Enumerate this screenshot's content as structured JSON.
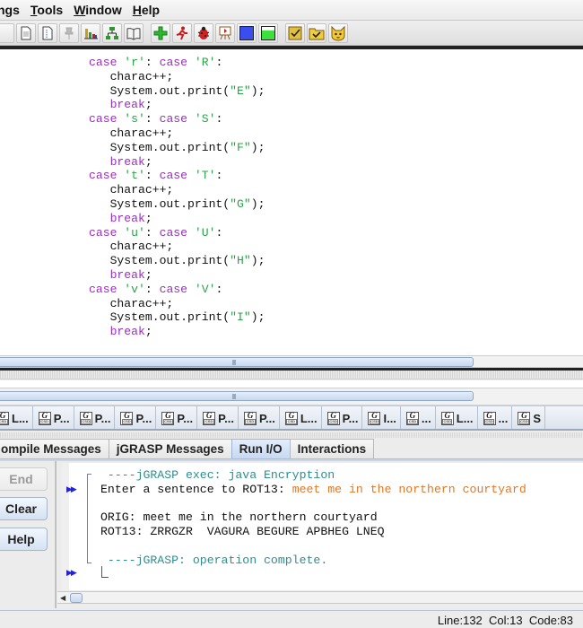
{
  "menubar": {
    "items": [
      {
        "label": "ngs",
        "mnemonic_index": -1
      },
      {
        "label": "Tools",
        "mnemonic_index": 0
      },
      {
        "label": "Window",
        "mnemonic_index": 0
      },
      {
        "label": "Help",
        "mnemonic_index": 0
      }
    ]
  },
  "toolbar": {
    "buttons": [
      {
        "icon": "partial-button"
      },
      {
        "icon": "new-file-icon"
      },
      {
        "icon": "generate-doc-icon"
      },
      {
        "icon": "pin-icon",
        "disabled": true
      },
      {
        "icon": "bar-chart-icon"
      },
      {
        "icon": "uml-diagram-icon"
      },
      {
        "icon": "open-book-icon"
      },
      {
        "icon": "compile-plus-icon"
      },
      {
        "icon": "run-figure-icon"
      },
      {
        "icon": "debug-bug-icon"
      },
      {
        "icon": "presentation-icon"
      },
      {
        "icon": "blue-square-icon"
      },
      {
        "icon": "green-square-icon"
      },
      {
        "icon": "checklist-icon"
      },
      {
        "icon": "folder-check-icon"
      },
      {
        "icon": "cat-face-icon"
      }
    ]
  },
  "editor": {
    "cases": [
      {
        "lower": "'r'",
        "upper": "'R'",
        "out": "\"E\""
      },
      {
        "lower": "'s'",
        "upper": "'S'",
        "out": "\"F\""
      },
      {
        "lower": "'t'",
        "upper": "'T'",
        "out": "\"G\""
      },
      {
        "lower": "'u'",
        "upper": "'U'",
        "out": "\"H\""
      },
      {
        "lower": "'v'",
        "upper": "'V'",
        "out": "\"I\""
      }
    ],
    "kw_case": "case",
    "kw_break": "break",
    "stmt_increment": "charac++;",
    "print_prefix": "System.out.print(",
    "print_suffix": ");"
  },
  "window_tabs": [
    {
      "label": "L..."
    },
    {
      "label": "P..."
    },
    {
      "label": "P..."
    },
    {
      "label": "P..."
    },
    {
      "label": "P..."
    },
    {
      "label": "P..."
    },
    {
      "label": "P..."
    },
    {
      "label": "L..."
    },
    {
      "label": "P..."
    },
    {
      "label": "I..."
    },
    {
      "label": "..."
    },
    {
      "label": "L..."
    },
    {
      "label": "..."
    },
    {
      "label": "S"
    }
  ],
  "message_tabs": [
    {
      "label": "ompile Messages",
      "active": false
    },
    {
      "label": "jGRASP Messages",
      "active": false
    },
    {
      "label": "Run I/O",
      "active": true
    },
    {
      "label": "Interactions",
      "active": false
    }
  ],
  "side_buttons": {
    "end": "End",
    "clear": "Clear",
    "help": "Help"
  },
  "run_io": {
    "exec_line": " ----jGRASP exec: java Encryption",
    "prompt": "Enter a sentence to ROT13: ",
    "user_input": "meet me in the northern courtyard",
    "orig_line": "ORIG: meet me in the northern courtyard",
    "rot13_line": "ROT13: ZRRGZR  VAGURA BEGURE APBHEG LNEQ",
    "complete_line": " ----jGRASP: operation complete."
  },
  "status": {
    "line": "Line:132",
    "col": "Col:13",
    "code": "Code:83"
  },
  "colors": {
    "keyword": "#9a2fc0",
    "string_literal": "#2aa34a",
    "jgrasp_message": "#2c8f8f",
    "user_input": "#e0782a",
    "arrow": "#2222dd",
    "active_tab": "#c7d9f1"
  }
}
